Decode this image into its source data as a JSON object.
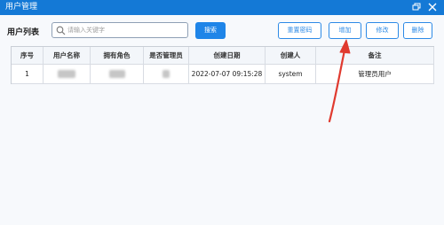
{
  "window": {
    "title": "用户管理",
    "buttons": [
      "restore-icon",
      "close-icon"
    ]
  },
  "toolbar": {
    "list_title": "用户列表",
    "search_placeholder": "请输入关键字",
    "search_button": "搜索",
    "reset_password": "重置密码",
    "add": "增加",
    "edit": "修改",
    "delete": "删除"
  },
  "table": {
    "columns": [
      "序号",
      "用户名称",
      "拥有角色",
      "是否管理员",
      "创建日期",
      "创建人",
      "备注"
    ],
    "rows": [
      {
        "index": "1",
        "create_date": "2022-07-07 09:15:28",
        "creator": "system",
        "note": "管理员用户"
      }
    ]
  },
  "colors": {
    "titlebar": "#1479d6",
    "primary": "#1f85e8",
    "annotation_arrow": "#e03a2f"
  }
}
